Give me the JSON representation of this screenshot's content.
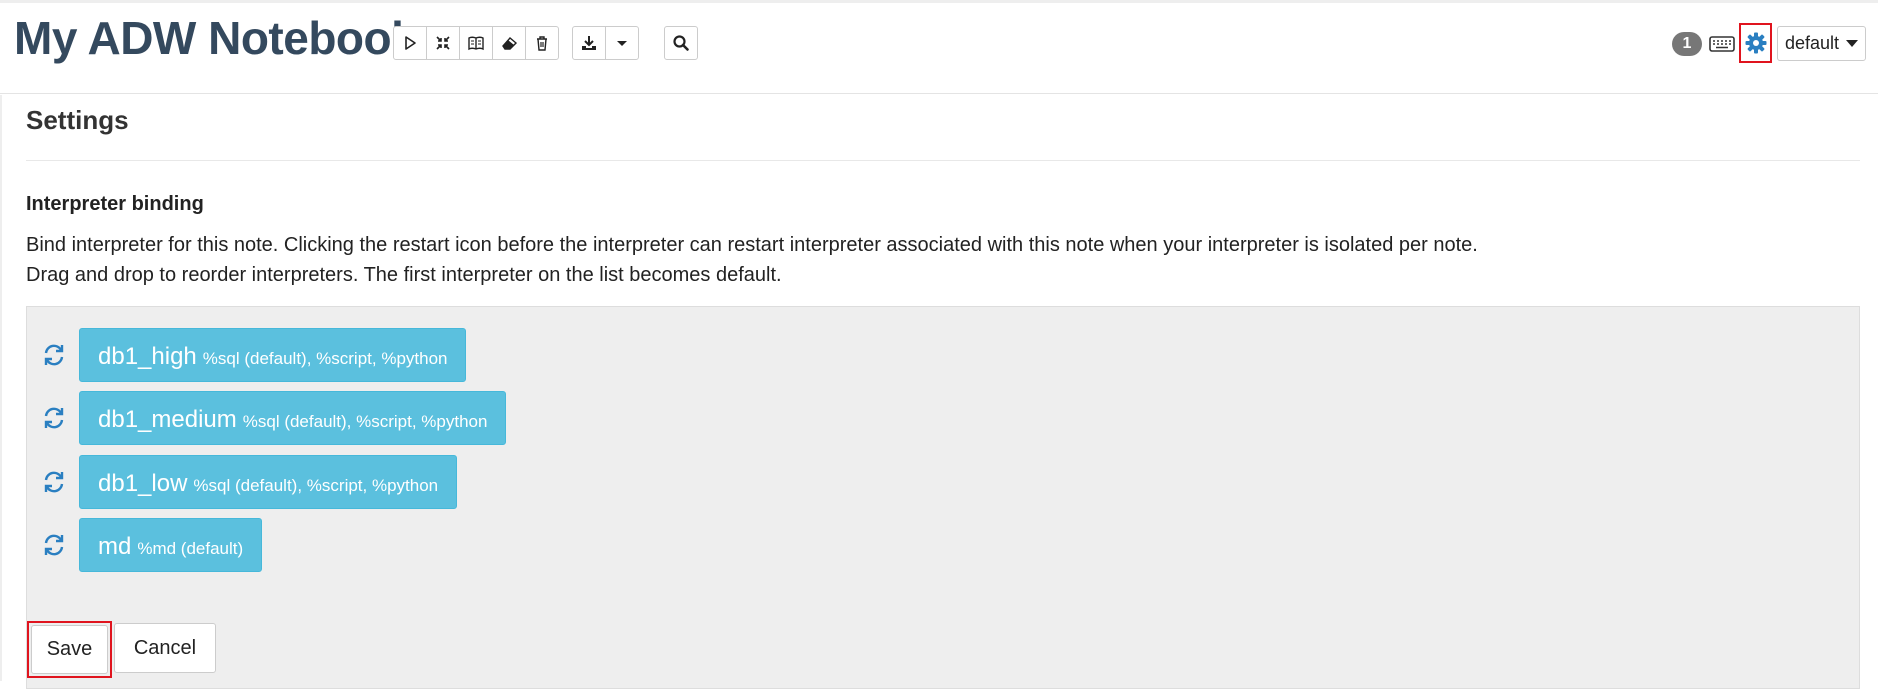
{
  "header": {
    "title": "My ADW Notebook",
    "toolbar_icons": [
      "run-all-icon",
      "collapse-icon",
      "book-icon",
      "eraser-icon",
      "trash-icon"
    ],
    "export_icons": [
      "download-icon",
      "dropdown-caret-icon"
    ],
    "search_icon": "search-icon",
    "connected_users_count": "1",
    "keyboard_icon": "keyboard-icon",
    "settings_icon": "gear-icon",
    "settings_highlight_color": "#e0141e",
    "mode_label": "default"
  },
  "settings": {
    "title": "Settings",
    "section_title": "Interpreter binding",
    "description_line1": "Bind interpreter for this note. Clicking the restart icon before the interpreter can restart interpreter associated with this note when your interpreter is isolated per note.",
    "description_line2": "Drag and drop to reorder interpreters. The first interpreter on the list becomes default.",
    "chip_color": "#5bc0de",
    "restart_icon": "refresh-icon",
    "interpreters": [
      {
        "name": "db1_high",
        "tags": "%sql (default), %script, %python"
      },
      {
        "name": "db1_medium",
        "tags": "%sql (default), %script, %python"
      },
      {
        "name": "db1_low",
        "tags": "%sql (default), %script, %python"
      },
      {
        "name": "md",
        "tags": "%md (default)"
      }
    ],
    "save_label": "Save",
    "cancel_label": "Cancel"
  }
}
